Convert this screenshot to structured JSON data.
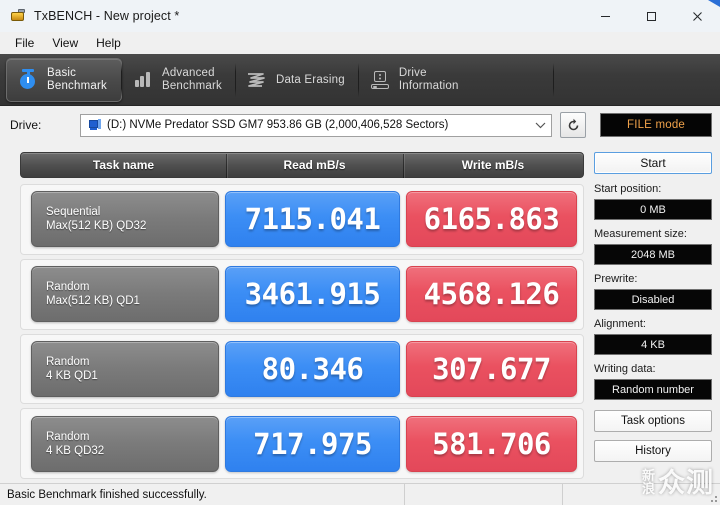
{
  "window": {
    "title": "TxBENCH - New project *",
    "app_icon": "disk-icon",
    "minimize": "minimize-icon",
    "maximize": "maximize-icon",
    "close": "close-icon"
  },
  "menu": {
    "items": [
      {
        "label": "File"
      },
      {
        "label": "View"
      },
      {
        "label": "Help"
      }
    ]
  },
  "tabs": [
    {
      "label": "Basic\nBenchmark",
      "icon": "stopwatch-icon",
      "active": true
    },
    {
      "label": "Advanced\nBenchmark",
      "icon": "bar-chart-icon",
      "active": false
    },
    {
      "label": "Data Erasing",
      "icon": "shredder-icon",
      "active": false
    },
    {
      "label": "Drive\nInformation",
      "icon": "drive-info-icon",
      "active": false
    }
  ],
  "drive": {
    "label": "Drive:",
    "icon": "drive-icon",
    "selected": "(D:) NVMe Predator SSD GM7  953.86 GB (2,000,406,528 Sectors)",
    "dropdown_arrow": "chevron-down-icon",
    "refresh_icon": "refresh-icon",
    "mode_button": "FILE mode",
    "mode_color": "#f0a24a"
  },
  "results": {
    "headers": {
      "task": "Task name",
      "read": "Read mB/s",
      "write": "Write mB/s"
    },
    "rows": [
      {
        "line1": "Sequential",
        "line2": "Max(512 KB) QD32",
        "read": "7115.041",
        "write": "6165.863"
      },
      {
        "line1": "Random",
        "line2": "Max(512 KB) QD1",
        "read": "3461.915",
        "write": "4568.126"
      },
      {
        "line1": "Random",
        "line2": "4 KB QD1",
        "read": "80.346",
        "write": "307.677"
      },
      {
        "line1": "Random",
        "line2": "4 KB QD32",
        "read": "717.975",
        "write": "581.706"
      }
    ],
    "read_color": "#3c8ef5",
    "write_color": "#ea5160"
  },
  "sidebar": {
    "start_button": "Start",
    "fields": [
      {
        "label": "Start position:",
        "value": "0 MB"
      },
      {
        "label": "Measurement size:",
        "value": "2048 MB"
      },
      {
        "label": "Prewrite:",
        "value": "Disabled"
      },
      {
        "label": "Alignment:",
        "value": "4 KB"
      },
      {
        "label": "Writing data:",
        "value": "Random number"
      }
    ],
    "task_options_button": "Task options",
    "history_button": "History"
  },
  "statusbar": {
    "message": "Basic Benchmark finished successfully.",
    "cell2": "",
    "cell3": ""
  },
  "watermark": {
    "line1": "新",
    "line2": "浪",
    "big": "众测"
  }
}
